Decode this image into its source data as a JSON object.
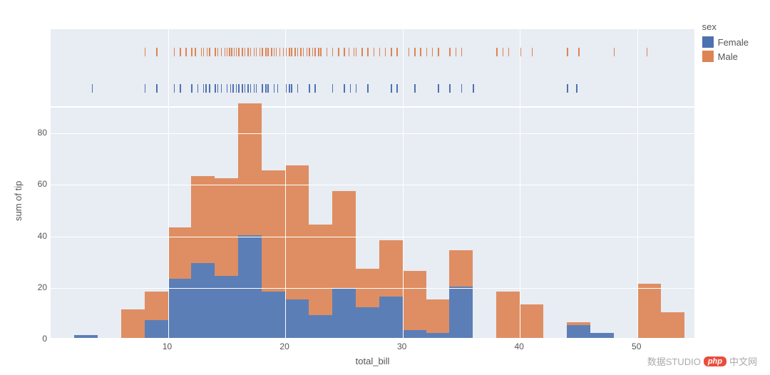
{
  "legend": {
    "title": "sex",
    "items": [
      {
        "label": "Female",
        "color": "#4c72b0"
      },
      {
        "label": "Male",
        "color": "#dd8452"
      }
    ]
  },
  "axes": {
    "xlabel": "total_bill",
    "ylabel": "sum of tip",
    "xticks": [
      10,
      20,
      30,
      40,
      50
    ],
    "yticks": [
      0,
      20,
      40,
      60,
      80
    ]
  },
  "watermark": {
    "text1": "数据STUDIO",
    "text2": "中文网",
    "badge": "php"
  },
  "chart_data": {
    "type": "bar",
    "title": "",
    "xlabel": "total_bill",
    "ylabel": "sum of tip",
    "xlim": [
      0,
      55
    ],
    "ylim": [
      0,
      90
    ],
    "bin_width": 2,
    "categories": [
      3,
      5,
      7,
      9,
      11,
      13,
      15,
      17,
      19,
      21,
      23,
      25,
      27,
      29,
      31,
      33,
      35,
      37,
      39,
      41,
      43,
      45,
      47,
      49,
      51,
      53
    ],
    "series": [
      {
        "name": "Female",
        "values": [
          1,
          0,
          0,
          7,
          23,
          29,
          24,
          40,
          18,
          15,
          9,
          19,
          12,
          16,
          3,
          2,
          20,
          0,
          0,
          0,
          0,
          5,
          2,
          0,
          0,
          0
        ]
      },
      {
        "name": "Male",
        "values": [
          0,
          0,
          11,
          11,
          20,
          34,
          38,
          51,
          47,
          52,
          35,
          38,
          15,
          22,
          23,
          13,
          14,
          0,
          18,
          13,
          0,
          1,
          0,
          0,
          21,
          10
        ]
      }
    ],
    "rug": {
      "Male": [
        8,
        9,
        10,
        10.5,
        11,
        11.5,
        12,
        12.3,
        12.8,
        13,
        13.3,
        13.5,
        14,
        14.2,
        14.5,
        14.8,
        15,
        15.2,
        15.4,
        15.6,
        15.8,
        16,
        16.3,
        16.5,
        16.8,
        17,
        17.3,
        17.5,
        17.8,
        18,
        18.3,
        18.5,
        18.8,
        19,
        19.2,
        19.5,
        19.8,
        20,
        20.3,
        20.5,
        20.8,
        21,
        21.3,
        21.5,
        21.8,
        22,
        22.3,
        22.5,
        22.8,
        23,
        23.5,
        24,
        24.5,
        25,
        25.4,
        25.8,
        26,
        26.5,
        27,
        27.5,
        28,
        28.5,
        29,
        29.5,
        30,
        30.5,
        31,
        31.5,
        32,
        32.5,
        33,
        34,
        34.5,
        35,
        38,
        38.5,
        39,
        40,
        41,
        44,
        45,
        48,
        50,
        50.8
      ],
      "Female": [
        3.5,
        8,
        9,
        10,
        10.5,
        11,
        12,
        12.5,
        13,
        13.2,
        13.5,
        14,
        14.2,
        14.5,
        15,
        15.3,
        15.5,
        15.8,
        16,
        16.3,
        16.5,
        16.8,
        17,
        17.3,
        17.5,
        18,
        18.3,
        18.5,
        19,
        19.3,
        20,
        20.3,
        20.5,
        21,
        22,
        22.5,
        24,
        25,
        25.5,
        26,
        27,
        29,
        29.5,
        30,
        31,
        33,
        34,
        35,
        36,
        44,
        44.8
      ]
    }
  }
}
